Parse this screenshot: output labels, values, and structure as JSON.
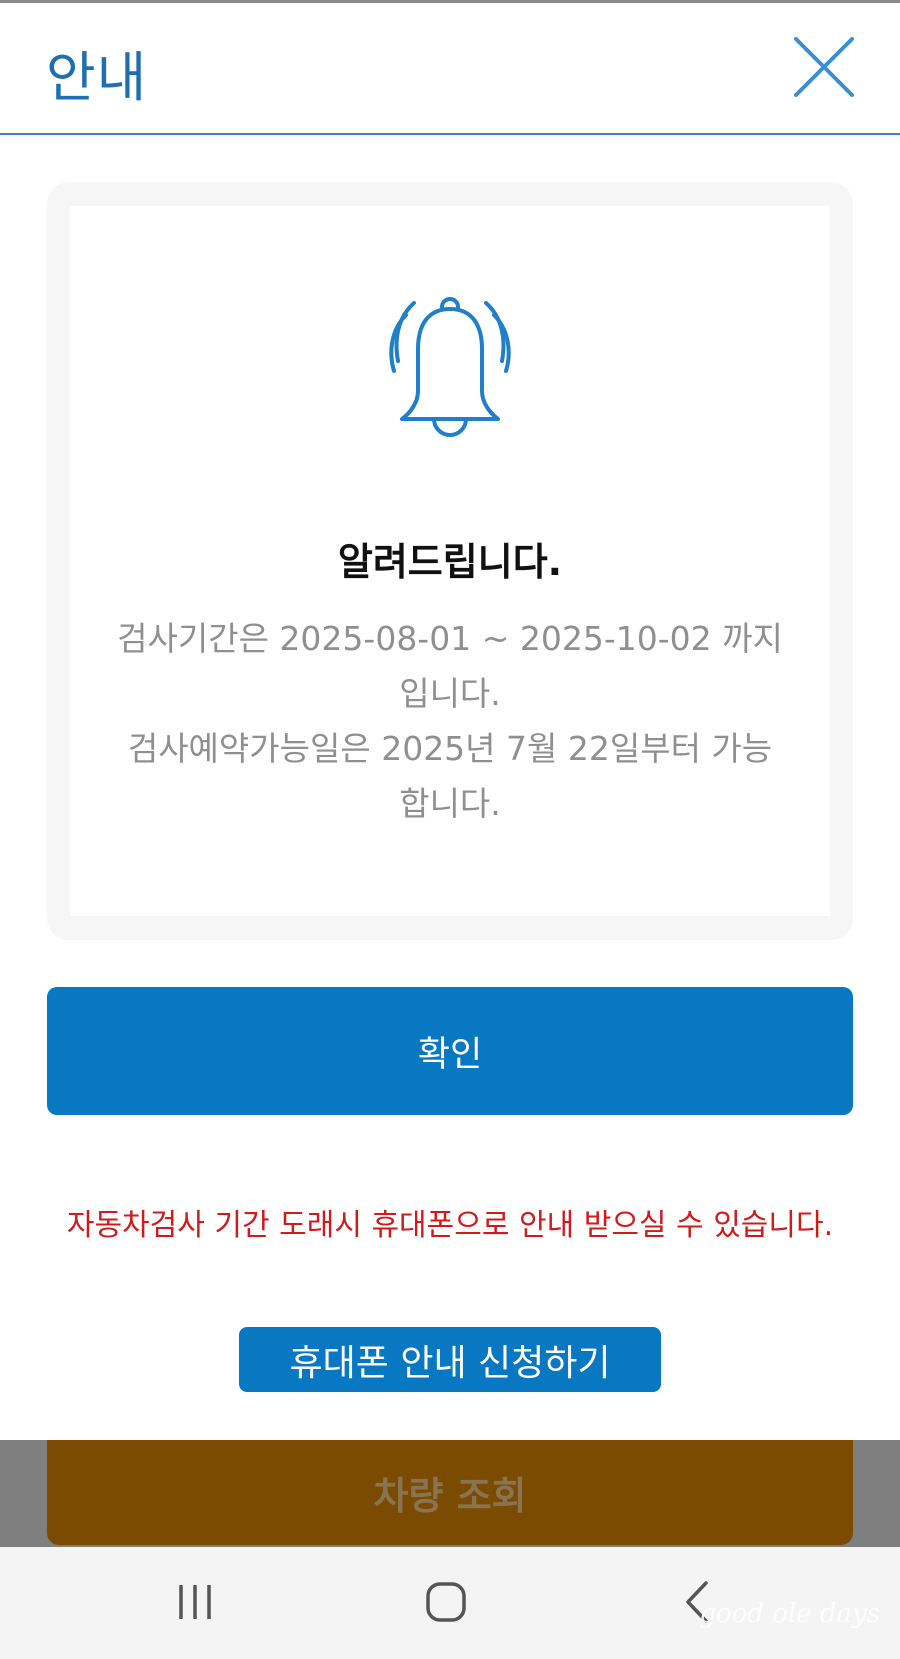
{
  "header": {
    "title": "안내"
  },
  "notice": {
    "title": "알려드립니다.",
    "lines": [
      "검사기간은 2025-08-01 ~ 2025-10-02 까지",
      "입니다.",
      "검사예약가능일은 2025년 7월 22일부터 가능",
      "합니다."
    ]
  },
  "buttons": {
    "confirm": "확인",
    "apply_sms": "휴대폰 안내 신청하기",
    "vehicle_lookup": "차량 조회"
  },
  "alert": {
    "text": "자동차검사 기간 도래시 휴대폰으로 안내 받으실 수 있습니다."
  },
  "watermark": "good ole days",
  "colors": {
    "primary_blue": "#0778c1",
    "title_blue": "#1f6fb0",
    "alert_red": "#d11a1a",
    "vehicle_brown": "#7a4b00"
  }
}
